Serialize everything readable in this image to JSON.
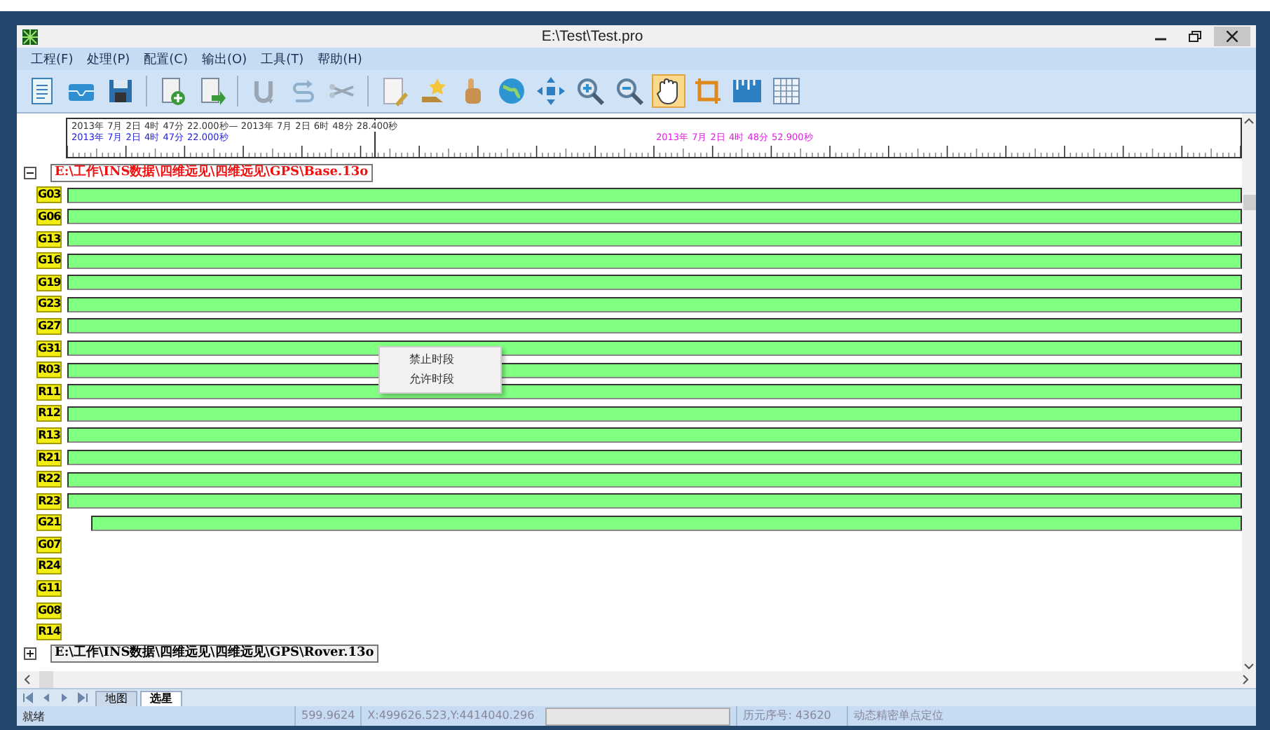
{
  "window": {
    "title": "E:\\Test\\Test.pro"
  },
  "menu": [
    "工程(F)",
    "处理(P)",
    "配置(C)",
    "输出(O)",
    "工具(T)",
    "帮助(H)"
  ],
  "toolbar": [
    [
      {
        "kind": "document",
        "selected": false
      },
      {
        "kind": "tray",
        "selected": false
      },
      {
        "kind": "save",
        "selected": false
      }
    ],
    [
      {
        "kind": "add-doc",
        "selected": false
      },
      {
        "kind": "export-doc",
        "selected": false
      }
    ],
    [
      {
        "kind": "magnet",
        "selected": false
      },
      {
        "kind": "redo",
        "selected": false
      },
      {
        "kind": "scissors",
        "selected": false
      }
    ],
    [
      {
        "kind": "edit-doc",
        "selected": false
      },
      {
        "kind": "star",
        "selected": false
      },
      {
        "kind": "finger",
        "selected": false
      },
      {
        "kind": "globe",
        "selected": false
      },
      {
        "kind": "move",
        "selected": false
      },
      {
        "kind": "zoom-in",
        "selected": false
      },
      {
        "kind": "zoom-out",
        "selected": false
      },
      {
        "kind": "hand",
        "selected": true
      },
      {
        "kind": "crop",
        "selected": false
      },
      {
        "kind": "ruler",
        "selected": false
      },
      {
        "kind": "grid",
        "selected": false
      }
    ]
  ],
  "timeline": {
    "range": "2013年 7月 2日 4时 47分 22.000秒— 2013年 7月 2日 6时 48分 28.400秒",
    "start": "2013年 7月 2日 4时 47分 22.000秒",
    "cursor": "2013年 7月 2日 4时 48分 52.900秒"
  },
  "files": [
    {
      "path": "E:\\工作\\INS数据\\四维远见\\四维远见\\GPS\\Base.13o",
      "expanded": true,
      "selected": true,
      "children": [
        {
          "name": "G03",
          "kind": "full"
        },
        {
          "name": "G06",
          "kind": "full"
        },
        {
          "name": "G13",
          "kind": "full"
        },
        {
          "name": "G16",
          "kind": "full"
        },
        {
          "name": "G19",
          "kind": "full"
        },
        {
          "name": "G23",
          "kind": "full"
        },
        {
          "name": "G27",
          "kind": "full"
        },
        {
          "name": "G31",
          "kind": "full"
        },
        {
          "name": "R03",
          "kind": "full"
        },
        {
          "name": "R11",
          "kind": "full"
        },
        {
          "name": "R12",
          "kind": "full"
        },
        {
          "name": "R13",
          "kind": "full"
        },
        {
          "name": "R21",
          "kind": "full"
        },
        {
          "name": "R22",
          "kind": "full"
        },
        {
          "name": "R23",
          "kind": "full"
        },
        {
          "name": "G21",
          "kind": "partial"
        },
        {
          "name": "G07",
          "kind": "none"
        },
        {
          "name": "R24",
          "kind": "none"
        },
        {
          "name": "G11",
          "kind": "none"
        },
        {
          "name": "G08",
          "kind": "none"
        },
        {
          "name": "R14",
          "kind": "none"
        }
      ]
    },
    {
      "path": "E:\\工作\\INS数据\\四维远见\\四维远见\\GPS\\Rover.13o",
      "expanded": false,
      "selected": false
    }
  ],
  "context_menu": [
    "禁止时段",
    "允许时段"
  ],
  "tabs": [
    {
      "label": "地图",
      "selected": false
    },
    {
      "label": "选星",
      "selected": true
    }
  ],
  "status_bar": {
    "message": "就绪",
    "value": "599.9624",
    "coords": "X:499626.523,Y:4414040.296",
    "epoch": "历元序号: 43620",
    "mode": "动态精密单点定位"
  }
}
